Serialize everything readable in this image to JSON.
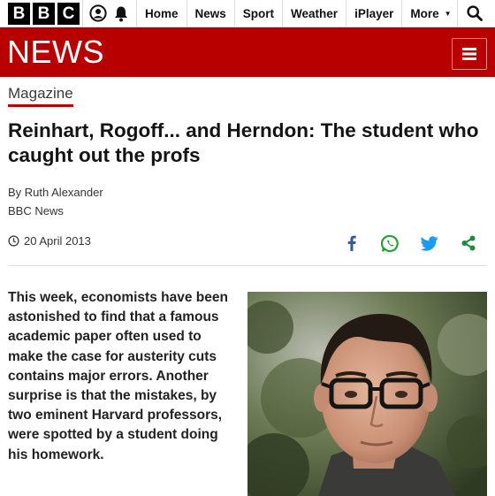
{
  "topnav": {
    "logo_letters": [
      "B",
      "B",
      "C"
    ],
    "account_icon": "user-circle-icon",
    "notifications_icon": "bell-icon",
    "items": [
      "Home",
      "News",
      "Sport",
      "Weather",
      "iPlayer"
    ],
    "more_label": "More",
    "search_icon": "search-icon"
  },
  "banner": {
    "title": "NEWS",
    "menu_icon": "hamburger-menu-icon",
    "color": "#b80000"
  },
  "article": {
    "section": "Magazine",
    "headline": "Reinhart, Rogoff... and Herndon: The student who caught out the profs",
    "author": "By Ruth Alexander",
    "source": "BBC News",
    "date": "20 April 2013",
    "share_icons": [
      "facebook-icon",
      "whatsapp-icon",
      "twitter-icon",
      "share-icon"
    ],
    "intro": "This week, economists have been astonished to find that a famous academic paper often used to make the case for austerity cuts contains major errors. Another surprise is that the mistakes, by two eminent Harvard professors, were spotted by a student doing his homework."
  }
}
